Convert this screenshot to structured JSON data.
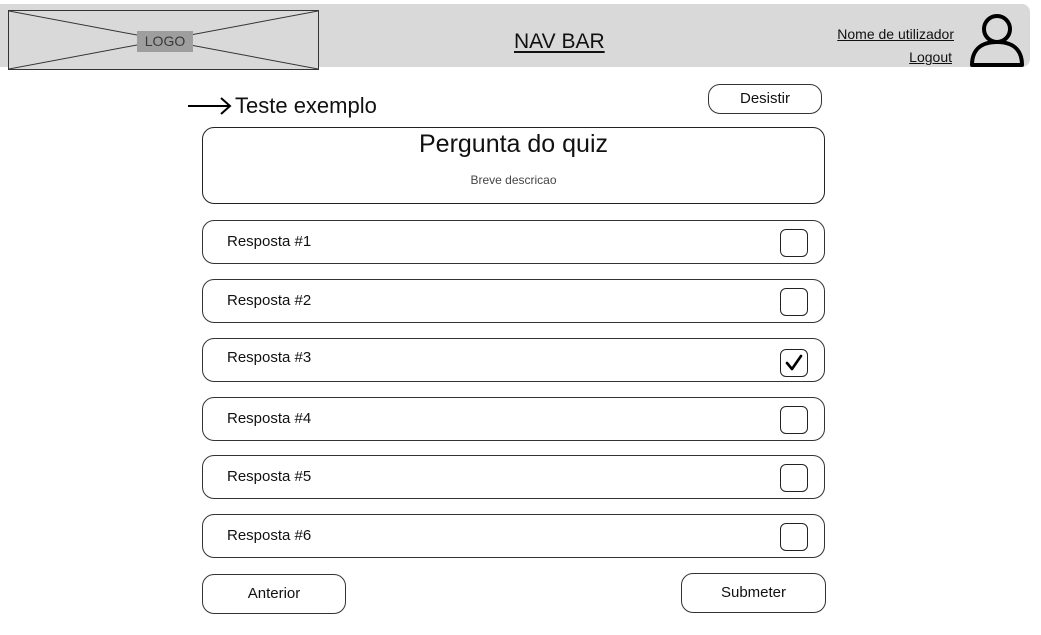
{
  "navbar": {
    "logo_text": "LOGO",
    "title": "NAV BAR",
    "user_name": "Nome de utilizador",
    "logout_label": "Logout",
    "user_icon": "user-icon"
  },
  "quiz": {
    "back_icon": "arrow-right-icon",
    "title": "Teste exemplo",
    "quit_label": "Desistir",
    "question": {
      "title": "Pergunta do quiz",
      "description": "Breve descricao"
    },
    "answers": [
      {
        "label": "Resposta #1",
        "checked": false
      },
      {
        "label": "Resposta #2",
        "checked": false
      },
      {
        "label": "Resposta #3",
        "checked": true
      },
      {
        "label": "Resposta #4",
        "checked": false
      },
      {
        "label": "Resposta #5",
        "checked": false
      },
      {
        "label": "Resposta #6",
        "checked": false
      }
    ],
    "previous_label": "Anterior",
    "submit_label": "Submeter"
  }
}
